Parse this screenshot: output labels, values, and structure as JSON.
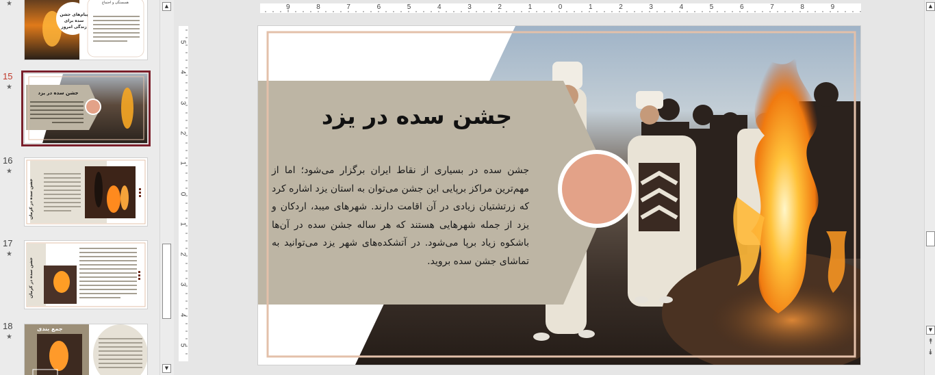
{
  "thumbnails": [
    {
      "number": "",
      "star": "★",
      "title": "پیام‌های جشن سده برای زندگی امروز",
      "subtitle": "همبستگی و اجتماع"
    },
    {
      "number": "15",
      "star": "★",
      "title": "جشن سده در یزد",
      "selected": true
    },
    {
      "number": "16",
      "star": "★",
      "title": "جشن سده در کرمان"
    },
    {
      "number": "17",
      "star": "★",
      "title": "جشن سده در کرمان"
    },
    {
      "number": "18",
      "star": "★",
      "title": "جمع بندی"
    }
  ],
  "ruler": {
    "horizontal": [
      "9",
      "8",
      "7",
      "6",
      "5",
      "4",
      "3",
      "2",
      "1",
      "0",
      "1",
      "2",
      "3",
      "4",
      "5",
      "6",
      "7",
      "8",
      "9"
    ],
    "vertical": [
      "5",
      "4",
      "3",
      "2",
      "1",
      "0",
      "1",
      "2",
      "3",
      "4",
      "5"
    ]
  },
  "slide": {
    "title": "جشن سده در یزد",
    "body": "جشن سده در بسیاری از نقاط ایران برگزار می‌شود؛ اما از مهم‌ترین مراکز برپایی این جشن می‌توان به استان یزد اشاره کرد که زرتشتیان زیادی در آن اقامت دارند. شهرهای میبد، اردکان و یزد از جمله شهرهایی هستند که هر ساله جشن سده در آن‌ها باشکوه زیاد برپا می‌شود. در آتشکده‌های شهر یزد می‌توانید به تماشای جشن سده بروید.",
    "colors": {
      "panel": "#bdb5a4",
      "circle": "#e3a288",
      "frame": "#e3c0aa"
    }
  },
  "icons": {
    "scroll_up": "▲",
    "scroll_down": "▼",
    "prev_slide": "⯭",
    "next_slide": "⯯"
  }
}
